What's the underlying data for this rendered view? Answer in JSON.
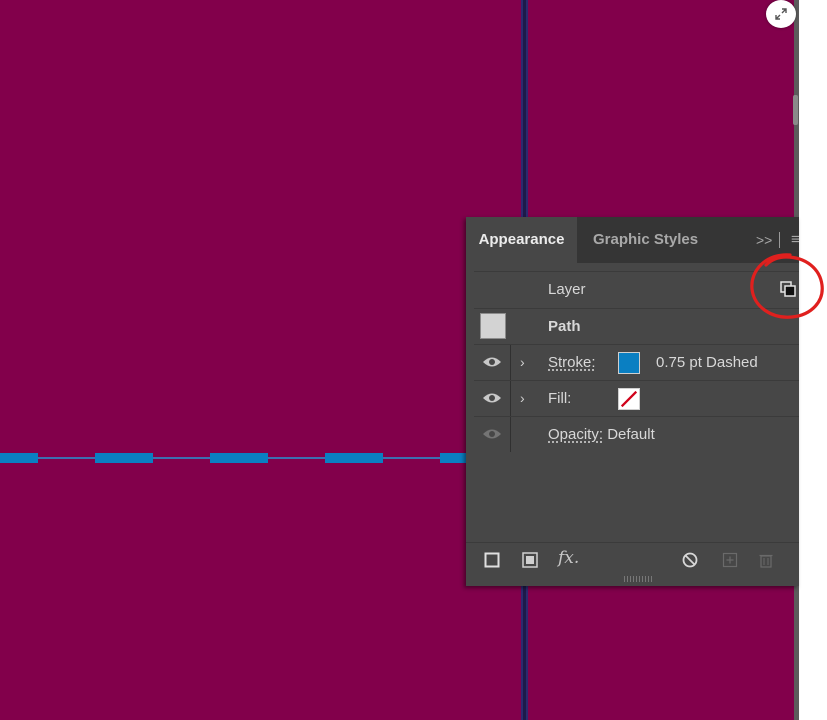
{
  "panel": {
    "tabs": [
      {
        "label": "Appearance",
        "active": true
      },
      {
        "label": "Graphic Styles",
        "active": false
      }
    ],
    "more_glyph": ">>",
    "menu_glyph": "≡",
    "header_row": {
      "label": "Layer"
    },
    "object_row": {
      "label": "Path"
    },
    "stroke_row": {
      "label": "Stroke:",
      "value": "0.75 pt Dashed",
      "swatch_color": "#0a7fc2"
    },
    "fill_row": {
      "label": "Fill:",
      "swatch": "none"
    },
    "opacity_row": {
      "label": "Opacity:",
      "value": "Default"
    },
    "bottom_icons": [
      "new-stroke-icon",
      "new-fill-icon",
      "fx-icon",
      "clear-appearance-icon",
      "duplicate-item-icon",
      "trash-icon"
    ],
    "fx_label": "fx."
  },
  "colors": {
    "canvas": "#82004b",
    "stroke_blue": "#0a7fc2",
    "annotation_red": "#e0201e"
  }
}
